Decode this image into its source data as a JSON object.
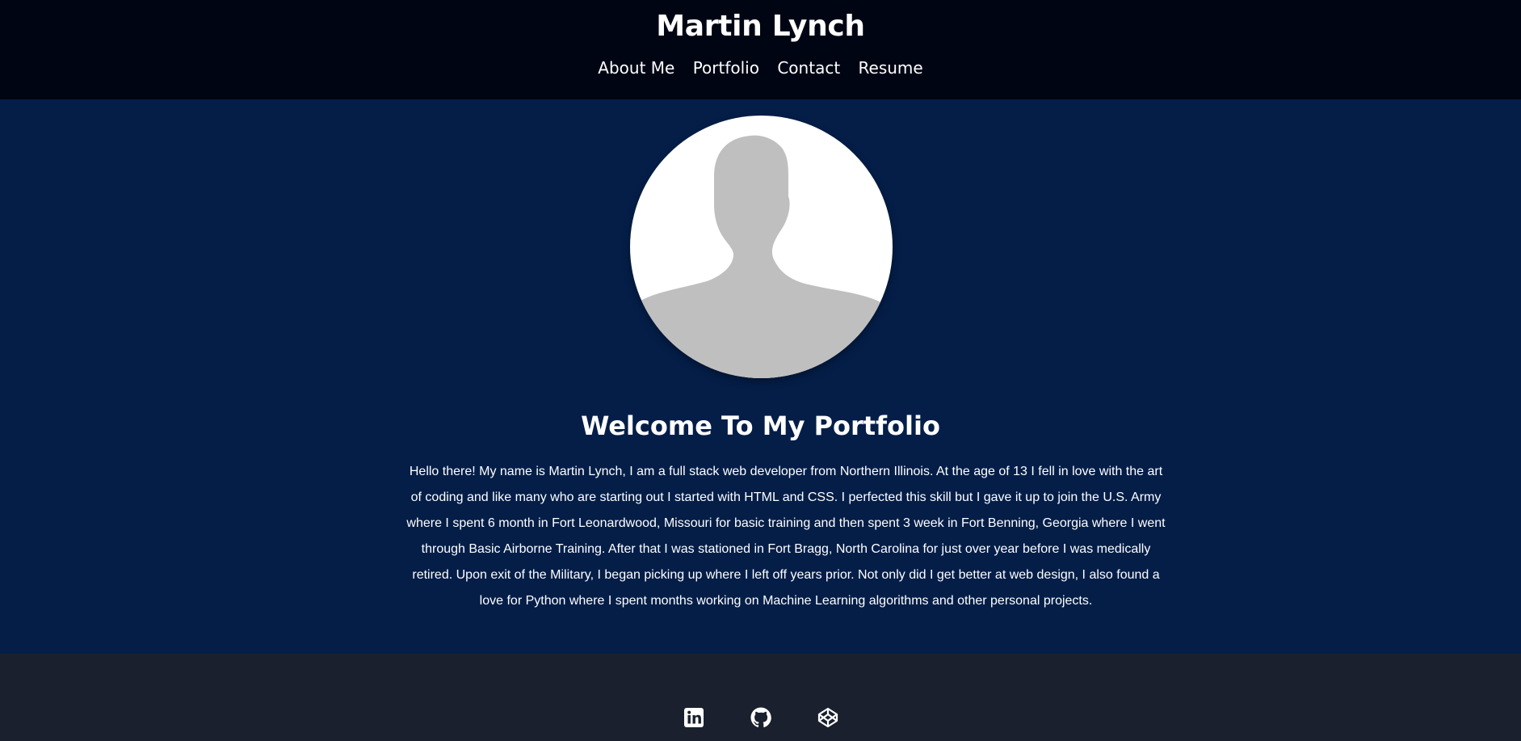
{
  "header": {
    "title": "Martin Lynch",
    "nav": [
      "About Me",
      "Portfolio",
      "Contact",
      "Resume"
    ]
  },
  "main": {
    "heading": "Welcome To My Portfolio",
    "bio": "Hello there! My name is Martin Lynch, I am a full stack web developer from Northern Illinois. At the age of 13 I fell in love with the art of coding and like many who are starting out I started with HTML and CSS. I perfected this skill but I gave it up to join the U.S. Army where I spent 6 month in Fort Leonardwood, Missouri for basic training and then spent 3 week in Fort Benning, Georgia where I went through Basic Airborne Training. After that I was stationed in Fort Bragg, North Carolina for just over year before I was medically retired. Upon exit of the Military, I began picking up where I left off years prior. Not only did I get better at web design, I also found a love for Python where I spent months working on Machine Learning algorithms and other personal projects."
  },
  "footer": {
    "social_icons": [
      "linkedin-icon",
      "github-icon",
      "codepen-icon"
    ]
  },
  "colors": {
    "header_bg": "#000514",
    "main_bg": "#041e48",
    "footer_bg": "#1a202e",
    "avatar_silhouette": "#bfbfbf"
  }
}
